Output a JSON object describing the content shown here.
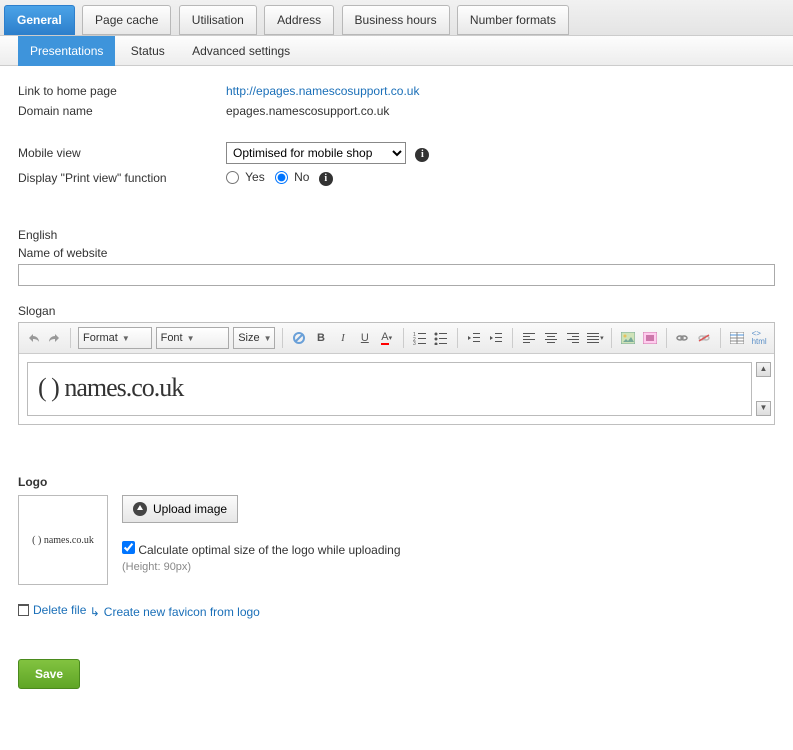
{
  "top_tabs": [
    "General",
    "Page cache",
    "Utilisation",
    "Address",
    "Business hours",
    "Number formats"
  ],
  "top_active": 0,
  "sub_tabs": [
    "Presentations",
    "Status",
    "Advanced settings"
  ],
  "sub_active": 0,
  "fields": {
    "link_label": "Link to home page",
    "link_value": "http://epages.namescosupport.co.uk",
    "domain_label": "Domain name",
    "domain_value": "epages.namescosupport.co.uk",
    "mobile_label": "Mobile view",
    "mobile_value": "Optimised for mobile shop",
    "printview_label": "Display \"Print view\" function",
    "yes": "Yes",
    "no": "No",
    "printview_value": "No",
    "language": "English",
    "name_label": "Name of website",
    "name_value": "",
    "slogan_label": "Slogan"
  },
  "editor": {
    "format": "Format",
    "font": "Font",
    "size": "Size",
    "content": "( ) names.co.uk"
  },
  "logo": {
    "heading": "Logo",
    "preview_text": "( ) names.co.uk",
    "upload": "Upload image",
    "calc_label": "Calculate optimal size of the logo while uploading",
    "calc_checked": true,
    "hint": "(Height: 90px)",
    "delete": "Delete file",
    "favicon": "Create new favicon from logo"
  },
  "save": "Save"
}
